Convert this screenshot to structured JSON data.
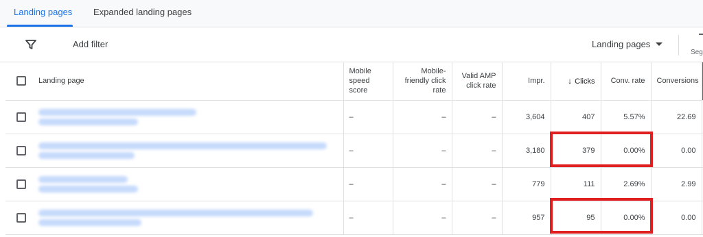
{
  "tabs": [
    {
      "label": "Landing pages",
      "active": true
    },
    {
      "label": "Expanded landing pages",
      "active": false
    }
  ],
  "toolbar": {
    "add_filter": "Add filter",
    "view_dropdown": "Landing pages",
    "segment_label": "Seg"
  },
  "table": {
    "headers": {
      "landing_page": "Landing page",
      "mobile_speed": "Mobile speed score",
      "mobile_friendly": "Mobile-friendly click rate",
      "valid_amp": "Valid AMP click rate",
      "impr": "Impr.",
      "clicks": "Clicks",
      "conv_rate": "Conv. rate",
      "conversions": "Conversions"
    },
    "rows": [
      {
        "mobile_speed": "–",
        "mobile_friendly": "–",
        "valid_amp": "–",
        "impr": "3,604",
        "clicks": "407",
        "conv_rate": "5.57%",
        "conversions": "22.69"
      },
      {
        "mobile_speed": "–",
        "mobile_friendly": "–",
        "valid_amp": "–",
        "impr": "3,180",
        "clicks": "379",
        "conv_rate": "0.00%",
        "conversions": "0.00"
      },
      {
        "mobile_speed": "–",
        "mobile_friendly": "–",
        "valid_amp": "–",
        "impr": "779",
        "clicks": "111",
        "conv_rate": "2.69%",
        "conversions": "2.99"
      },
      {
        "mobile_speed": "–",
        "mobile_friendly": "–",
        "valid_amp": "–",
        "impr": "957",
        "clicks": "95",
        "conv_rate": "0.00%",
        "conversions": "0.00"
      }
    ]
  },
  "colors": {
    "accent": "#1a73e8",
    "highlight": "#e02020",
    "blurred_link": "#c6dafc"
  }
}
